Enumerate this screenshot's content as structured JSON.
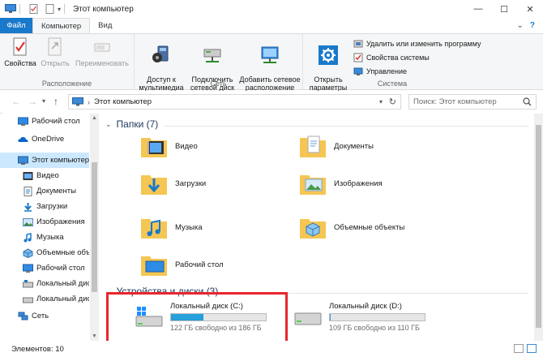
{
  "window": {
    "title": "Этот компьютер",
    "minimize": "—",
    "maximize": "☐",
    "close": "✕"
  },
  "ribbon_tabs": {
    "file": "Файл",
    "computer": "Компьютер",
    "view": "Вид",
    "collapse": "⌄",
    "help": "?"
  },
  "ribbon": {
    "location_group": {
      "label": "Расположение",
      "properties": "Свойства",
      "open": "Открыть",
      "rename": "Переименовать"
    },
    "network_group": {
      "label": "Сеть",
      "media_access": "Доступ к\nмультимедиа",
      "map_drive": "Подключить\nсетевой диск",
      "add_network_location": "Добавить сетевое\nрасположение"
    },
    "system_group": {
      "label": "Система",
      "open_settings": "Открыть\nпараметры",
      "uninstall": "Удалить или изменить программу",
      "system_properties": "Свойства системы",
      "manage": "Управление"
    }
  },
  "address": {
    "path": "Этот компьютер",
    "search_placeholder": "Поиск: Этот компьютер"
  },
  "nav": {
    "items": [
      {
        "label": "Рабочий стол",
        "icon": "desktop-icon"
      },
      {
        "label": "OneDrive",
        "icon": "onedrive-icon"
      },
      {
        "label": "Этот компьютер",
        "icon": "computer-icon"
      },
      {
        "label": "Видео",
        "icon": "video-folder-icon"
      },
      {
        "label": "Документы",
        "icon": "documents-icon"
      },
      {
        "label": "Загрузки",
        "icon": "downloads-icon"
      },
      {
        "label": "Изображения",
        "icon": "pictures-icon"
      },
      {
        "label": "Музыка",
        "icon": "music-icon"
      },
      {
        "label": "Объемные объекты",
        "icon": "3d-objects-icon"
      },
      {
        "label": "Рабочий стол",
        "icon": "desktop-icon"
      },
      {
        "label": "Локальный диск",
        "icon": "drive-icon"
      },
      {
        "label": "Локальный диск",
        "icon": "drive-icon"
      },
      {
        "label": "Сеть",
        "icon": "network-icon"
      }
    ]
  },
  "content": {
    "folders_header": "Папки (7)",
    "folders": [
      {
        "label": "Видео",
        "icon": "video-folder-icon"
      },
      {
        "label": "Документы",
        "icon": "documents-folder-icon"
      },
      {
        "label": "Загрузки",
        "icon": "downloads-folder-icon"
      },
      {
        "label": "Изображения",
        "icon": "pictures-folder-icon"
      },
      {
        "label": "Музыка",
        "icon": "music-folder-icon"
      },
      {
        "label": "Объемные объекты",
        "icon": "3d-objects-folder-icon"
      },
      {
        "label": "Рабочий стол",
        "icon": "desktop-folder-icon"
      }
    ],
    "drives_header": "Устройства и диски (3)",
    "drives": [
      {
        "name": "Локальный диск (C:)",
        "free": "122 ГБ свободно из 186 ГБ",
        "used_fraction": 0.344
      },
      {
        "name": "Локальный диск (D:)",
        "free": "109 ГБ свободно из 110 ГБ",
        "used_fraction": 0.009
      }
    ]
  },
  "status": {
    "items": "Элементов: 10"
  },
  "colors": {
    "accent": "#1979ca",
    "selection": "#cce8ff",
    "drive_bar": "#26a0da",
    "highlight": "#e8262d"
  }
}
